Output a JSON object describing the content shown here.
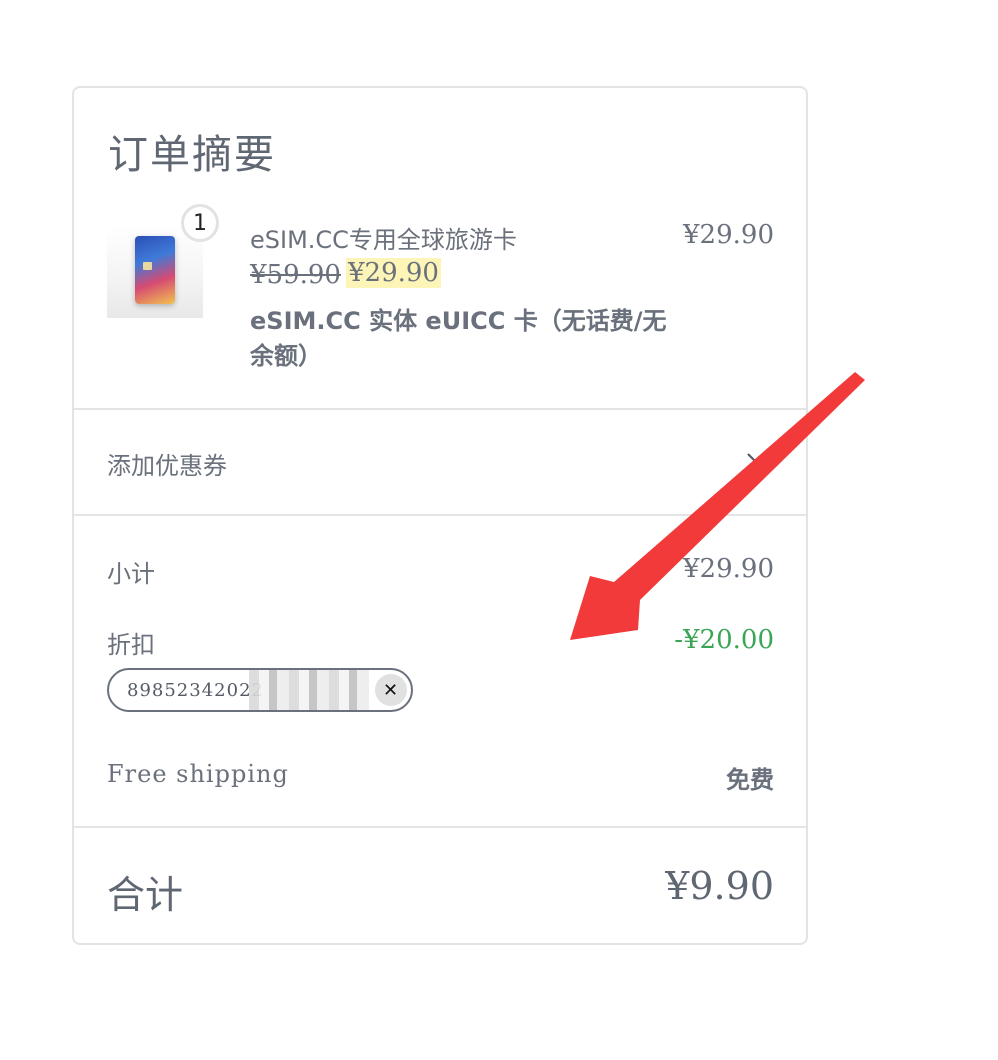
{
  "summary": {
    "title": "订单摘要"
  },
  "product": {
    "quantity": "1",
    "name": "eSIM.CC专用全球旅游卡",
    "original_price": "¥59.90",
    "sale_price": "¥29.90",
    "variant": "eSIM.CC 实体 eUICC 卡（无话费/无余额）",
    "line_total": "¥29.90",
    "image_icon": "esim-card-product-image"
  },
  "coupon": {
    "toggle_label": "添加优惠券",
    "toggle_icon": "chevron-down-icon"
  },
  "totals": {
    "subtotal_label": "小计",
    "subtotal_value": "¥29.90",
    "discount_label": "折扣",
    "discount_value": "-¥20.00",
    "applied_code": "89852342022",
    "remove_icon": "close-icon",
    "shipping_label": "Free shipping",
    "shipping_value": "免费",
    "total_label": "合计",
    "total_value": "¥9.90"
  },
  "colors": {
    "text": "#5f6773",
    "discount": "#3aa655",
    "highlight": "#fdf5b8",
    "border": "#e4e4e4",
    "annotation_arrow": "#f23a3a"
  }
}
